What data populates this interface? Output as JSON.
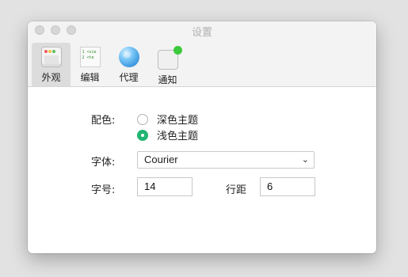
{
  "window": {
    "title": "设置"
  },
  "toolbar": {
    "items": [
      {
        "label": "外观",
        "icon": "appearance-icon",
        "active": true
      },
      {
        "label": "编辑",
        "icon": "code-editor-icon",
        "active": false
      },
      {
        "label": "代理",
        "icon": "globe-icon",
        "active": false
      },
      {
        "label": "通知",
        "icon": "notification-icon",
        "active": false
      }
    ],
    "code_icon_lines": [
      "1 <vie",
      "2  <te"
    ]
  },
  "form": {
    "color_scheme": {
      "label": "配色:",
      "options": [
        {
          "label": "深色主题",
          "checked": false
        },
        {
          "label": "浅色主题",
          "checked": true
        }
      ],
      "accent": "#22b573"
    },
    "font": {
      "label": "字体:",
      "value": "Courier"
    },
    "font_size": {
      "label": "字号:",
      "value": "14"
    },
    "line_spacing": {
      "label": "行距",
      "value": "6"
    }
  }
}
